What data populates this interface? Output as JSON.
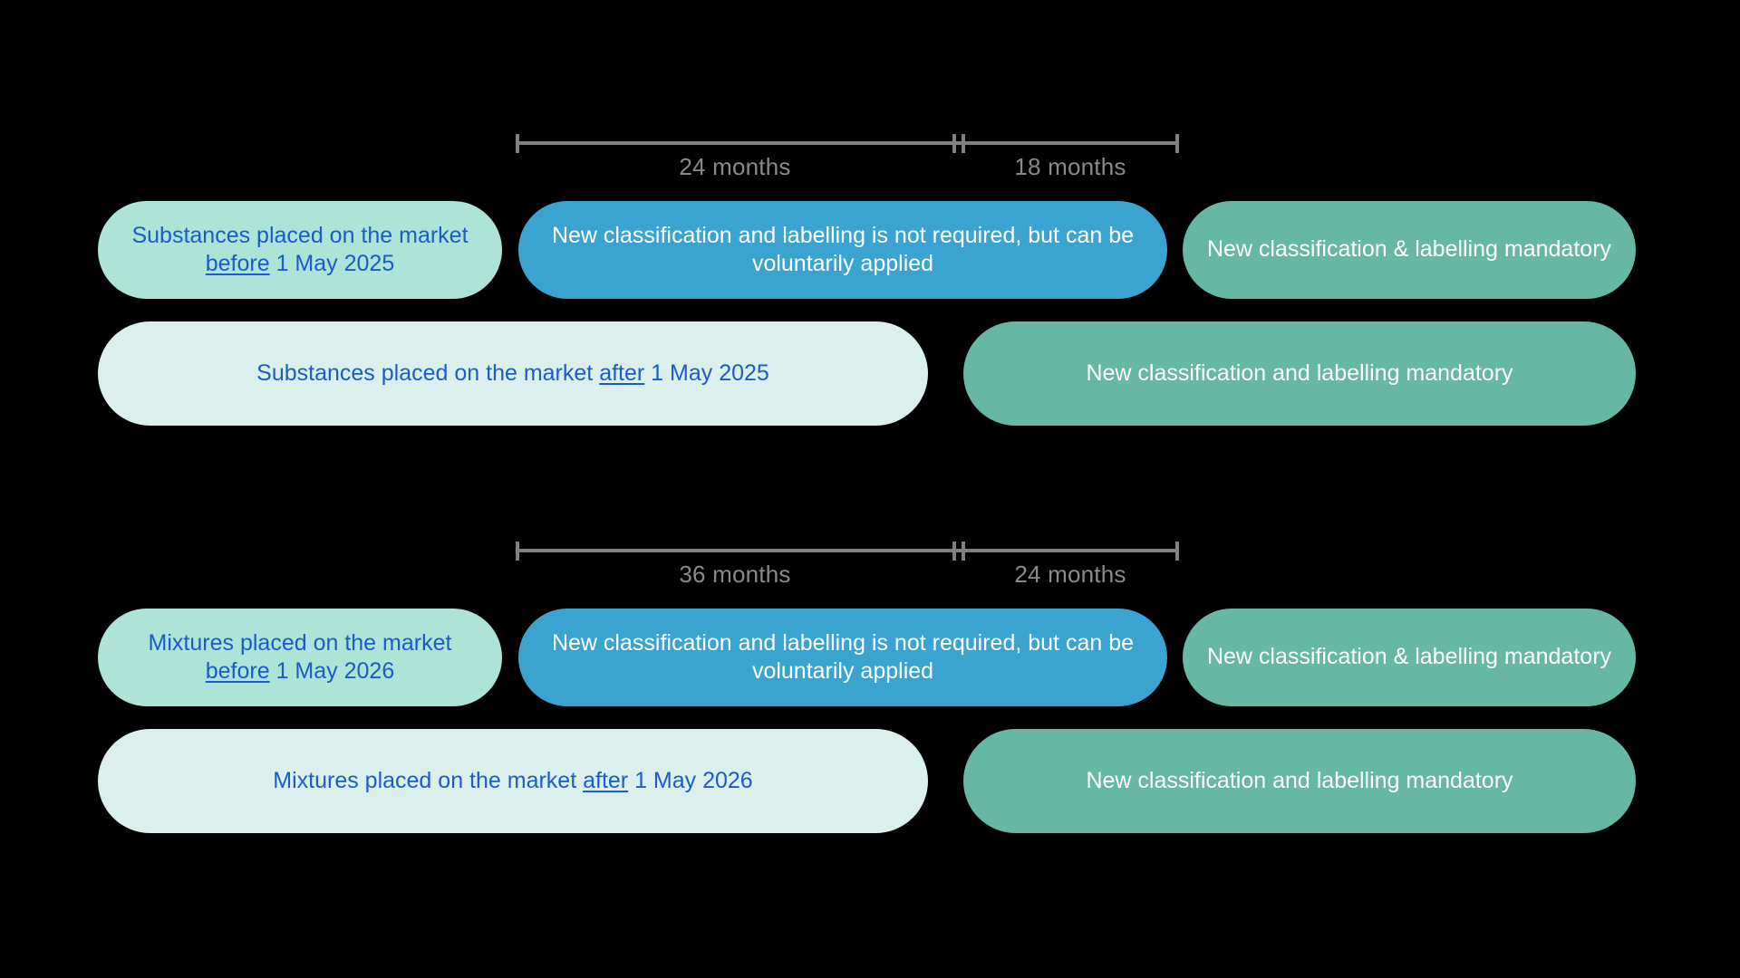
{
  "background_color": "#000000",
  "palette": {
    "mint": "#aee3d8",
    "pale_mint": "#dbf0ec",
    "blue": "#3ba3d0",
    "green": "#66b8a5",
    "blue_text": "#1a5cc8",
    "gray_line": "#808080",
    "gray_text": "#8a8a8a",
    "white_text": "#ffffff"
  },
  "groups": [
    {
      "id": "substances",
      "measure": {
        "left_label": "24 months",
        "right_label": "18 months"
      },
      "before_row": {
        "left": {
          "prefix": "Substances placed on the market ",
          "emphasis": "before",
          "suffix": " 1 May 2025"
        },
        "middle": "New classification and labelling is not required, but can be voluntarily applied",
        "right": "New classification & labelling mandatory"
      },
      "after_row": {
        "left": {
          "prefix": "Substances placed on the market ",
          "emphasis": "after",
          "suffix": " 1 May 2025"
        },
        "right": "New classification and labelling mandatory"
      }
    },
    {
      "id": "mixtures",
      "measure": {
        "left_label": "36 months",
        "right_label": "24 months"
      },
      "before_row": {
        "left": {
          "prefix": "Mixtures placed on the market ",
          "emphasis": "before",
          "suffix": " 1 May 2026"
        },
        "middle": "New classification and labelling is not required, but can be voluntarily applied",
        "right": "New classification & labelling mandatory"
      },
      "after_row": {
        "left": {
          "prefix": "Mixtures placed on the market ",
          "emphasis": "after",
          "suffix": " 1 May 2026"
        },
        "right": "New classification and labelling mandatory"
      }
    }
  ]
}
